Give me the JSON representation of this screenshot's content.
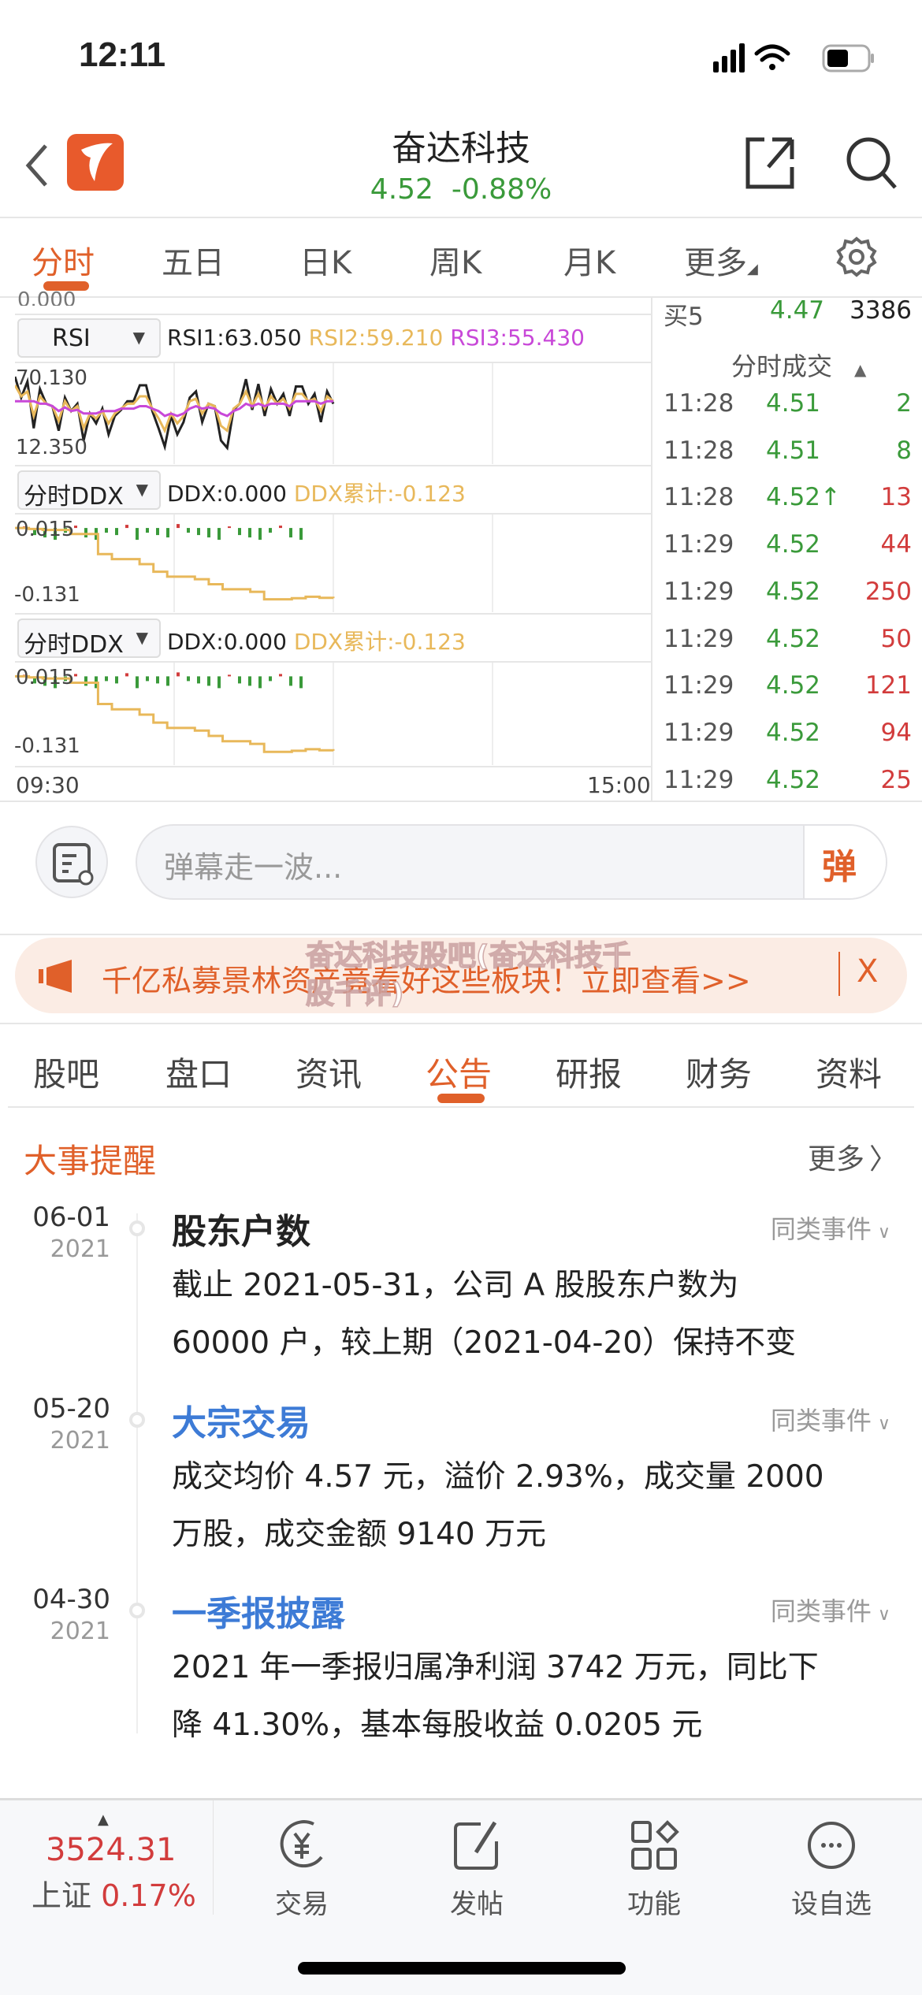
{
  "status_bar": {
    "time": "12:11"
  },
  "header": {
    "title": "奋达科技",
    "price": "4.52",
    "change": "-0.88%"
  },
  "chart_tabs": [
    {
      "label": "分时",
      "active": true
    },
    {
      "label": "五日"
    },
    {
      "label": "日K"
    },
    {
      "label": "周K"
    },
    {
      "label": "月K"
    },
    {
      "label": "更多"
    }
  ],
  "chart": {
    "top_partial_label": "0.000",
    "rsi": {
      "selector": "RSI",
      "rsi1": "RSI1:63.050",
      "rsi2": "RSI2:59.210",
      "rsi3": "RSI3:55.430",
      "max_label": "70.130",
      "min_label": "12.350",
      "ylim": [
        12.35,
        70.13
      ],
      "rsi1_values": [
        72,
        55,
        68,
        30,
        62,
        50,
        48,
        28,
        55,
        44,
        50,
        20,
        42,
        34,
        46,
        25,
        40,
        45,
        52,
        52,
        65,
        65,
        44,
        30,
        15,
        40,
        25,
        35,
        55,
        60,
        35,
        50,
        48,
        20,
        14,
        45,
        50,
        70,
        45,
        66,
        40,
        62,
        50,
        58,
        40,
        64,
        64,
        50,
        58,
        35,
        60,
        50
      ],
      "rsi2_values": [
        65,
        56,
        60,
        40,
        56,
        50,
        48,
        36,
        52,
        44,
        48,
        30,
        42,
        38,
        44,
        34,
        42,
        46,
        50,
        50,
        56,
        56,
        46,
        38,
        28,
        42,
        34,
        40,
        52,
        54,
        42,
        50,
        48,
        32,
        28,
        46,
        50,
        60,
        48,
        58,
        46,
        56,
        50,
        54,
        46,
        58,
        58,
        52,
        54,
        44,
        56,
        52
      ],
      "rsi3_values": [
        52,
        52,
        52,
        52,
        50,
        50,
        48,
        44,
        47,
        44,
        45,
        42,
        42,
        42,
        44,
        44,
        44,
        46,
        46,
        46,
        48,
        48,
        46,
        44,
        40,
        42,
        40,
        42,
        46,
        48,
        46,
        47,
        46,
        42,
        40,
        44,
        46,
        50,
        48,
        50,
        48,
        50,
        50,
        50,
        48,
        52,
        52,
        52,
        52,
        50,
        52,
        52
      ]
    },
    "ddx_panels": [
      {
        "selector": "分时DDX",
        "ddx": "DDX:0.000",
        "ddx_cum": "DDX累计:-0.123",
        "max_label": "0.015",
        "min_label": "-0.131"
      },
      {
        "selector": "分时DDX",
        "ddx": "DDX:0.000",
        "ddx_cum": "DDX累计:-0.123",
        "max_label": "0.015",
        "min_label": "-0.131"
      }
    ],
    "ddx_ylim": [
      -0.14,
      0.02
    ],
    "ddx_cum_values": [
      0.012,
      0.01,
      0.008,
      0.008,
      0.0,
      0.0,
      -0.04,
      -0.05,
      -0.05,
      -0.06,
      -0.075,
      -0.085,
      -0.085,
      -0.09,
      -0.1,
      -0.11,
      -0.11,
      -0.115,
      -0.13,
      -0.13,
      -0.128,
      -0.125,
      -0.127,
      -0.128
    ],
    "time_start": "09:30",
    "time_end": "15:00",
    "colors": {
      "rsi1": "#222222",
      "rsi2": "#e8b85a",
      "rsi3": "#c848d8",
      "ddx_cum": "#e8b85a",
      "up": "#d23c3c",
      "down": "#3a9a3a"
    }
  },
  "order_book": {
    "label": "买5",
    "price": "4.47",
    "volume": "3386"
  },
  "trades": {
    "title": "分时成交",
    "rows": [
      {
        "time": "11:28",
        "price": "4.51",
        "vol": "2",
        "dir": "down"
      },
      {
        "time": "11:28",
        "price": "4.51",
        "vol": "8",
        "dir": "down"
      },
      {
        "time": "11:28",
        "price": "4.52↑",
        "vol": "13",
        "dir": "up"
      },
      {
        "time": "11:29",
        "price": "4.52",
        "vol": "44",
        "dir": "up"
      },
      {
        "time": "11:29",
        "price": "4.52",
        "vol": "250",
        "dir": "up"
      },
      {
        "time": "11:29",
        "price": "4.52",
        "vol": "50",
        "dir": "up"
      },
      {
        "time": "11:29",
        "price": "4.52",
        "vol": "121",
        "dir": "up"
      },
      {
        "time": "11:29",
        "price": "4.52",
        "vol": "94",
        "dir": "up"
      },
      {
        "time": "11:29",
        "price": "4.52",
        "vol": "25",
        "dir": "up"
      }
    ]
  },
  "danmaku": {
    "placeholder": "弹幕走一波...",
    "send": "弹"
  },
  "banner": {
    "text": "千亿私募景林资产竟看好这些板块！立即查看>>",
    "close": "X",
    "watermark": "奋达科技股吧(奋达科技千股千评)"
  },
  "info_tabs": [
    {
      "label": "股吧"
    },
    {
      "label": "盘口"
    },
    {
      "label": "资讯"
    },
    {
      "label": "公告",
      "active": true
    },
    {
      "label": "研报"
    },
    {
      "label": "财务"
    },
    {
      "label": "资料"
    }
  ],
  "events": {
    "title": "大事提醒",
    "more": "更多",
    "similar": "同类事件",
    "items": [
      {
        "date": "06-01",
        "year": "2021",
        "title": "股东户数",
        "line1": "截止 2021-05-31，公司 A 股股东户数为",
        "line2": "60000 户，较上期（2021-04-20）保持不变",
        "color": "#222222"
      },
      {
        "date": "05-20",
        "year": "2021",
        "title": "大宗交易",
        "line1": "成交均价 4.57 元，溢价 2.93%，成交量 2000",
        "line2": "万股，成交金额 9140 万元",
        "color": "#3d7bd6"
      },
      {
        "date": "04-30",
        "year": "2021",
        "title": "一季报披露",
        "line1": "2021 年一季报归属净利润 3742 万元，同比下",
        "line2": "降 41.30%，基本每股收益 0.0205 元",
        "color": "#3d7bd6"
      }
    ]
  },
  "bottom_bar": {
    "index_value": "3524.31",
    "index_name": "上证",
    "index_change": "0.17%",
    "items": [
      {
        "label": "交易",
        "icon": "yuan-cycle-icon"
      },
      {
        "label": "发帖",
        "icon": "edit-icon"
      },
      {
        "label": "功能",
        "icon": "grid-icon"
      },
      {
        "label": "设自选",
        "icon": "more-circle-icon"
      }
    ]
  }
}
